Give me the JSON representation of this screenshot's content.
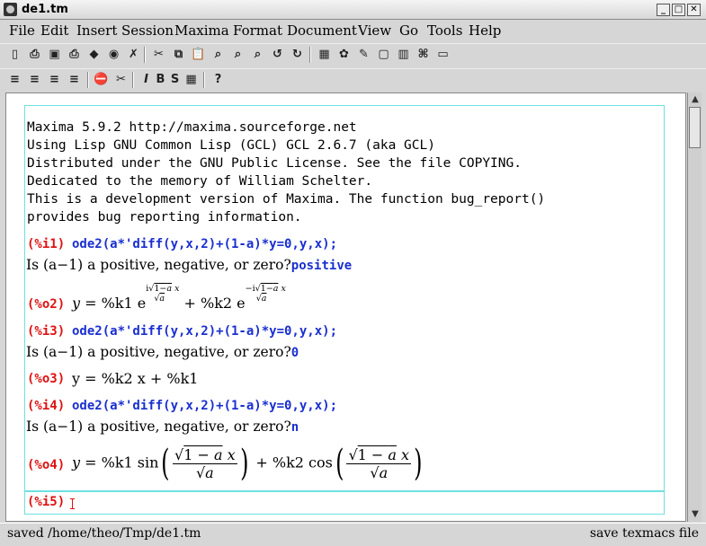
{
  "window": {
    "title": "de1.tm",
    "minimize": "_",
    "maximize": "□",
    "close": "✕"
  },
  "menu": [
    "File",
    "Edit",
    "Insert",
    "Session",
    "Maxima",
    "Format",
    "Document",
    "View",
    "Go",
    "Tools",
    "Help"
  ],
  "toolbar1": [
    {
      "name": "new-doc-icon",
      "glyph": "▯"
    },
    {
      "name": "open-icon",
      "glyph": "⎙"
    },
    {
      "name": "save-icon",
      "glyph": "▣"
    },
    {
      "name": "print-icon",
      "glyph": "⎙"
    },
    {
      "name": "package-icon",
      "glyph": "◆"
    },
    {
      "name": "globe-icon",
      "glyph": "◉"
    },
    {
      "name": "close-doc-icon",
      "glyph": "✗"
    },
    {
      "name": "cut-icon",
      "glyph": "✂"
    },
    {
      "name": "copy-icon",
      "glyph": "⧉"
    },
    {
      "name": "paste-icon",
      "glyph": "📋"
    },
    {
      "name": "find-icon",
      "glyph": "⌕"
    },
    {
      "name": "replace-icon",
      "glyph": "⌕"
    },
    {
      "name": "spell-icon",
      "glyph": "⌕"
    },
    {
      "name": "undo-icon",
      "glyph": "↺"
    },
    {
      "name": "redo-icon",
      "glyph": "↻"
    },
    {
      "name": "table-icon",
      "glyph": "▦"
    },
    {
      "name": "palette-icon",
      "glyph": "✿"
    },
    {
      "name": "pen-icon",
      "glyph": "✎"
    },
    {
      "name": "frame-icon",
      "glyph": "▢"
    },
    {
      "name": "film-icon",
      "glyph": "▥"
    },
    {
      "name": "network-icon",
      "glyph": "⌘"
    },
    {
      "name": "computer-icon",
      "glyph": "▭"
    }
  ],
  "toolbar2": [
    {
      "name": "align-left-icon",
      "glyph": "≡"
    },
    {
      "name": "align-center-icon",
      "glyph": "≡"
    },
    {
      "name": "align-right-icon",
      "glyph": "≡"
    },
    {
      "name": "justify-icon",
      "glyph": "≡"
    },
    {
      "name": "stop-icon",
      "glyph": "⛔"
    },
    {
      "name": "scissors-icon",
      "glyph": "✂"
    },
    {
      "name": "italic-button",
      "glyph": "I"
    },
    {
      "name": "bold-button",
      "glyph": "B"
    },
    {
      "name": "sans-serif-button",
      "glyph": "S"
    },
    {
      "name": "color-icon",
      "glyph": "▦"
    },
    {
      "name": "help-icon",
      "glyph": "?"
    }
  ],
  "session": {
    "banner": [
      "Maxima 5.9.2 http://maxima.sourceforge.net",
      "Using Lisp GNU Common Lisp (GCL) GCL 2.6.7 (aka GCL)",
      "Distributed under the GNU Public License. See the file COPYING.",
      "Dedicated to the memory of William Schelter.",
      "This is a development version of Maxima. The function bug_report()",
      "provides bug reporting information."
    ],
    "i1": {
      "label": "(%i1)",
      "cmd": "ode2(a*'diff(y,x,2)+(1-a)*y=0,y,x);"
    },
    "q1": {
      "prefix": "Is (a−1) a positive, negative, or zero?",
      "answer": "positive"
    },
    "o2": {
      "label": "(%o2)"
    },
    "i3": {
      "label": "(%i3)",
      "cmd": "ode2(a*'diff(y,x,2)+(1-a)*y=0,y,x);"
    },
    "q3": {
      "prefix": "Is (a−1) a positive, negative, or zero?",
      "answer": "0"
    },
    "o3": {
      "label": "(%o3)",
      "expr": "y = %k2 x + %k1"
    },
    "i4": {
      "label": "(%i4)",
      "cmd": "ode2(a*'diff(y,x,2)+(1-a)*y=0,y,x);"
    },
    "q4": {
      "prefix": "Is (a−1) a positive, negative, or zero?",
      "answer": "n"
    },
    "o4": {
      "label": "(%o4)"
    },
    "i5": {
      "label": "(%i5)"
    }
  },
  "status": {
    "left": "saved /home/theo/Tmp/de1.tm",
    "right": "save texmacs file"
  },
  "colors": {
    "prompt": "#e01010",
    "input": "#1a2fd0",
    "session_border": "#6fe0e0"
  }
}
